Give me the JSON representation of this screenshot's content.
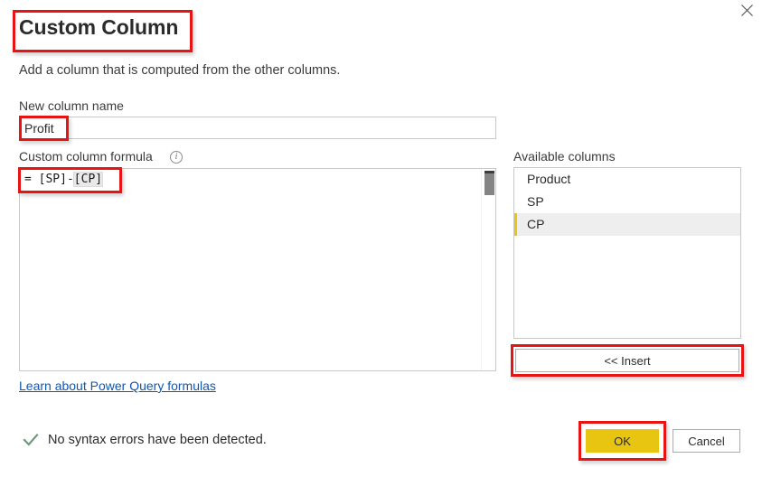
{
  "dialog": {
    "title": "Custom Column",
    "subtitle": "Add a column that is computed from the other columns.",
    "close_icon": "close-icon"
  },
  "new_column": {
    "label": "New column name",
    "value": "Profit",
    "placeholder": ""
  },
  "formula": {
    "label": "Custom column formula",
    "info_icon": "info-icon",
    "info_glyph": "i",
    "prefix": "= [SP]-",
    "highlight": "[CP]",
    "full_text": "= [SP]-[CP]"
  },
  "learn_link": {
    "label": "Learn about Power Query formulas"
  },
  "status": {
    "icon": "checkmark-icon",
    "text": "No syntax errors have been detected."
  },
  "available_columns": {
    "label": "Available columns",
    "items": [
      {
        "label": "Product",
        "selected": false
      },
      {
        "label": "SP",
        "selected": false
      },
      {
        "label": "CP",
        "selected": true
      }
    ]
  },
  "buttons": {
    "insert": "<< Insert",
    "ok": "OK",
    "cancel": "Cancel"
  },
  "colors": {
    "accent_gold": "#e8c511",
    "annotation_red": "#e81414",
    "link_blue": "#0f56b3",
    "check_green": "#6b9b7a",
    "selection_gray": "#eeeeee"
  }
}
